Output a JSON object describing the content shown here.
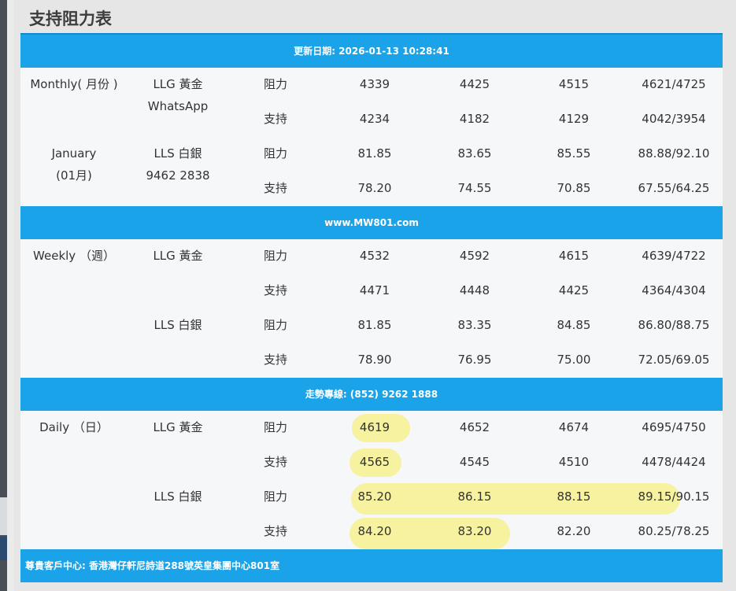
{
  "title": "支持阻力表",
  "bands": {
    "updated": "更新日期: 2026-01-13 10:28:41",
    "website": "www.MW801.com",
    "hotline": "走勢專線: (852) 9262 1888",
    "footer": "尊貴客戶中心: 香港灣仔軒尼詩道288號英皇集團中心801室"
  },
  "monthly": {
    "period": "Monthly( 月份 )",
    "month": "January",
    "month_cn": "(01月)",
    "gold_label": "LLG 黃金",
    "whatsapp": "WhatsApp",
    "silver_label": "LLS 白銀",
    "phone": "9462 2838",
    "rows": [
      {
        "type": "阻力",
        "v": [
          "4339",
          "4425",
          "4515",
          "4621/4725"
        ]
      },
      {
        "type": "支持",
        "v": [
          "4234",
          "4182",
          "4129",
          "4042/3954"
        ]
      },
      {
        "type": "阻力",
        "v": [
          "81.85",
          "83.65",
          "85.55",
          "88.88/92.10"
        ]
      },
      {
        "type": "支持",
        "v": [
          "78.20",
          "74.55",
          "70.85",
          "67.55/64.25"
        ]
      }
    ]
  },
  "weekly": {
    "period": "Weekly （週）",
    "gold_label": "LLG 黃金",
    "silver_label": "LLS 白銀",
    "rows": [
      {
        "type": "阻力",
        "v": [
          "4532",
          "4592",
          "4615",
          "4639/4722"
        ]
      },
      {
        "type": "支持",
        "v": [
          "4471",
          "4448",
          "4425",
          "4364/4304"
        ]
      },
      {
        "type": "阻力",
        "v": [
          "81.85",
          "83.35",
          "84.85",
          "86.80/88.75"
        ]
      },
      {
        "type": "支持",
        "v": [
          "78.90",
          "76.95",
          "75.00",
          "72.05/69.05"
        ]
      }
    ]
  },
  "daily": {
    "period": "Daily （日）",
    "gold_label": "LLG 黃金",
    "silver_label": "LLS 白銀",
    "rows": [
      {
        "type": "阻力",
        "v": [
          "4619",
          "4652",
          "4674",
          "4695/4750"
        ]
      },
      {
        "type": "支持",
        "v": [
          "4565",
          "4545",
          "4510",
          "4478/4424"
        ]
      },
      {
        "type": "阻力",
        "v": [
          "85.20",
          "86.15",
          "88.15",
          "89.15/90.15"
        ]
      },
      {
        "type": "支持",
        "v": [
          "84.20",
          "83.20",
          "82.20",
          "80.25/78.25"
        ]
      }
    ]
  },
  "highlight_color": "#f6f29f",
  "band_color": "#1aa3e8"
}
